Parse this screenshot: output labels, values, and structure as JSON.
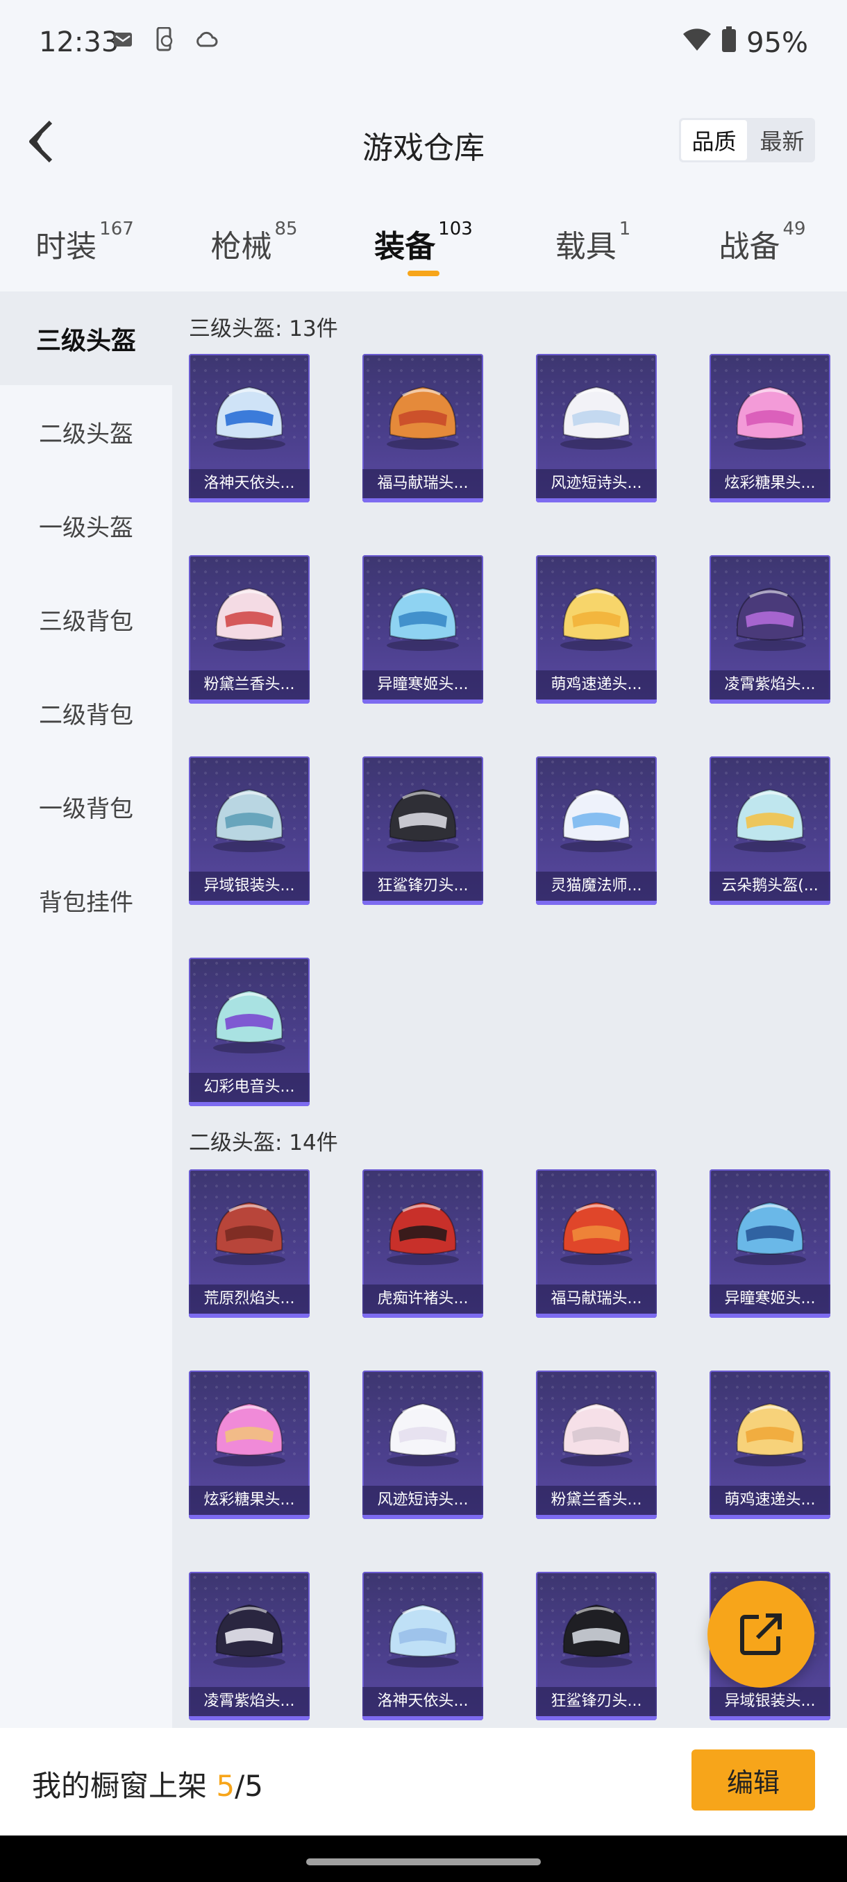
{
  "status": {
    "time": "12:33",
    "battery": "95%"
  },
  "header": {
    "title": "游戏仓库",
    "sort": [
      "品质",
      "最新"
    ]
  },
  "tabs": [
    {
      "label": "时装",
      "count": "167"
    },
    {
      "label": "枪械",
      "count": "85"
    },
    {
      "label": "装备",
      "count": "103",
      "active": true
    },
    {
      "label": "载具",
      "count": "1"
    },
    {
      "label": "战备",
      "count": "49"
    }
  ],
  "sidebar": [
    "三级头盔",
    "二级头盔",
    "一级头盔",
    "三级背包",
    "二级背包",
    "一级背包",
    "背包挂件"
  ],
  "sections": [
    {
      "title": "三级头盔: 13件",
      "items": [
        {
          "name": "洛神天依头...",
          "colors": [
            "#cfe3f7",
            "#2a6fd6"
          ]
        },
        {
          "name": "福马献瑞头...",
          "colors": [
            "#e58a3a",
            "#c94a2a"
          ]
        },
        {
          "name": "风迹短诗头...",
          "colors": [
            "#f2f2f7",
            "#bfd6ee"
          ]
        },
        {
          "name": "炫彩糖果头...",
          "colors": [
            "#f39bd8",
            "#d85ab8"
          ]
        },
        {
          "name": "粉黛兰香头...",
          "colors": [
            "#f4dbe4",
            "#d24a4a"
          ]
        },
        {
          "name": "异瞳寒姬头...",
          "colors": [
            "#8fd3f2",
            "#3a8ac8"
          ]
        },
        {
          "name": "萌鸡速递头...",
          "colors": [
            "#f7d56a",
            "#f2b23a"
          ]
        },
        {
          "name": "凌霄紫焰头...",
          "colors": [
            "#4a3a7a",
            "#b06ad8"
          ]
        },
        {
          "name": "异域银装头...",
          "colors": [
            "#b9d6e2",
            "#5fa0b8"
          ]
        },
        {
          "name": "狂鲨锋刃头...",
          "colors": [
            "#2f2f36",
            "#d8d8e0"
          ]
        },
        {
          "name": "灵猫魔法师...",
          "colors": [
            "#eef2fb",
            "#7ab8f0"
          ]
        },
        {
          "name": "云朵鹅头盔(...",
          "colors": [
            "#bfe6ee",
            "#f2c24a"
          ]
        },
        {
          "name": "幻彩电音头...",
          "colors": [
            "#a9e2e2",
            "#7a4ad0"
          ]
        }
      ]
    },
    {
      "title": "二级头盔: 14件",
      "items": [
        {
          "name": "荒原烈焰头...",
          "colors": [
            "#b8453a",
            "#7a2a22"
          ]
        },
        {
          "name": "虎痴许褚头...",
          "colors": [
            "#c8302a",
            "#2a1a1a"
          ]
        },
        {
          "name": "福马献瑞头...",
          "colors": [
            "#e0462a",
            "#f08a3a"
          ]
        },
        {
          "name": "异瞳寒姬头...",
          "colors": [
            "#6ab8e8",
            "#2a5a9a"
          ]
        },
        {
          "name": "炫彩糖果头...",
          "colors": [
            "#f08ad8",
            "#f2c080"
          ]
        },
        {
          "name": "风迹短诗头...",
          "colors": [
            "#f6f6fa",
            "#e6e0ee"
          ]
        },
        {
          "name": "粉黛兰香头...",
          "colors": [
            "#f6e0e8",
            "#d8c8d0"
          ]
        },
        {
          "name": "萌鸡速递头...",
          "colors": [
            "#f7d27a",
            "#f0a83a"
          ]
        },
        {
          "name": "凌霄紫焰头...",
          "colors": [
            "#2a2640",
            "#e8e8f0"
          ]
        },
        {
          "name": "洛神天依头...",
          "colors": [
            "#bfe0f6",
            "#9ac0ea"
          ]
        },
        {
          "name": "狂鲨锋刃头...",
          "colors": [
            "#1f1f24",
            "#cfd4dc"
          ]
        },
        {
          "name": "异域银装头...",
          "colors": [
            "#b8d0da",
            "#6a8aa0"
          ]
        }
      ]
    }
  ],
  "bottom": {
    "showcase_prefix": "我的橱窗上架 ",
    "showcase_count": "5",
    "showcase_total": "/5",
    "edit_label": "编辑"
  }
}
